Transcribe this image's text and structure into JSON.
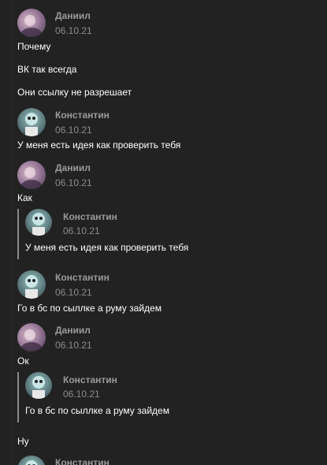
{
  "messages": [
    {
      "author": "Даниил",
      "date": "06.10.21",
      "lines": [
        "Почему",
        "ВК так всегда",
        "Они ссылку не разрешает"
      ]
    },
    {
      "author": "Константин",
      "date": "06.10.21",
      "lines": [
        "У меня есть идея как проверить тебя"
      ]
    },
    {
      "author": "Даниил",
      "date": "06.10.21",
      "lines": [
        "Как"
      ],
      "quote": {
        "author": "Константин",
        "date": "06.10.21",
        "text": "У меня есть идея как проверить тебя"
      }
    },
    {
      "author": "Константин",
      "date": "06.10.21",
      "lines": [
        "Го в бс по сыллке а руму зайдем"
      ]
    },
    {
      "author": "Даниил",
      "date": "06.10.21",
      "lines": [
        "Ок"
      ],
      "quote": {
        "author": "Константин",
        "date": "06.10.21",
        "text": "Го в бс по сыллке а руму зайдем"
      }
    },
    {
      "lines": [
        "Ну"
      ]
    },
    {
      "author": "Константин"
    }
  ]
}
